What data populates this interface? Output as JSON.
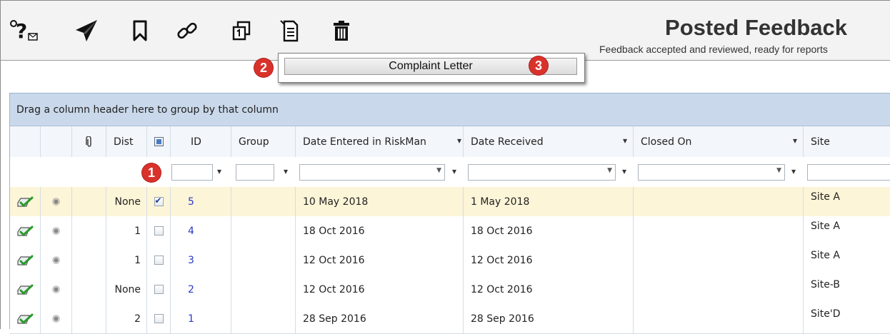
{
  "toolbar": {
    "icons": [
      "help-icon",
      "send-icon",
      "bookmark-icon",
      "link-icon",
      "copy-icon",
      "document-icon",
      "delete-icon"
    ]
  },
  "header": {
    "title": "Posted Feedback",
    "subtitle": "Feedback accepted and reviewed, ready for reports"
  },
  "popup": {
    "item_label": "Complaint Letter"
  },
  "callouts": [
    "1",
    "2",
    "3"
  ],
  "grid": {
    "group_hint": "Drag a column header here to group by that column",
    "columns": [
      "Dist",
      "ID",
      "Group",
      "Date Entered in RiskMan",
      "Date Received",
      "Closed On",
      "Site"
    ],
    "rows": [
      {
        "dist": "None",
        "checked": true,
        "id": "5",
        "group": "",
        "date_entered": "10 May 2018",
        "date_received": "1 May 2018",
        "closed_on": "",
        "site": "Site A"
      },
      {
        "dist": "1",
        "checked": false,
        "id": "4",
        "group": "",
        "date_entered": "18 Oct 2016",
        "date_received": "18 Oct 2016",
        "closed_on": "",
        "site": "Site A"
      },
      {
        "dist": "1",
        "checked": false,
        "id": "3",
        "group": "",
        "date_entered": "12 Oct 2016",
        "date_received": "12 Oct 2016",
        "closed_on": "",
        "site": "Site A"
      },
      {
        "dist": "None",
        "checked": false,
        "id": "2",
        "group": "",
        "date_entered": "12 Oct 2016",
        "date_received": "12 Oct 2016",
        "closed_on": "",
        "site": "Site-B"
      },
      {
        "dist": "2",
        "checked": false,
        "id": "1",
        "group": "",
        "date_entered": "28 Sep 2016",
        "date_received": "28 Sep 2016",
        "closed_on": "",
        "site": "Site'D"
      }
    ]
  },
  "colors": {
    "group_panel": "#c9d8ea",
    "selected_row": "#fdf5d8",
    "callout": "#d9322b",
    "id_link": "#2a3ac8",
    "row_ok": "#2a9a2a"
  }
}
